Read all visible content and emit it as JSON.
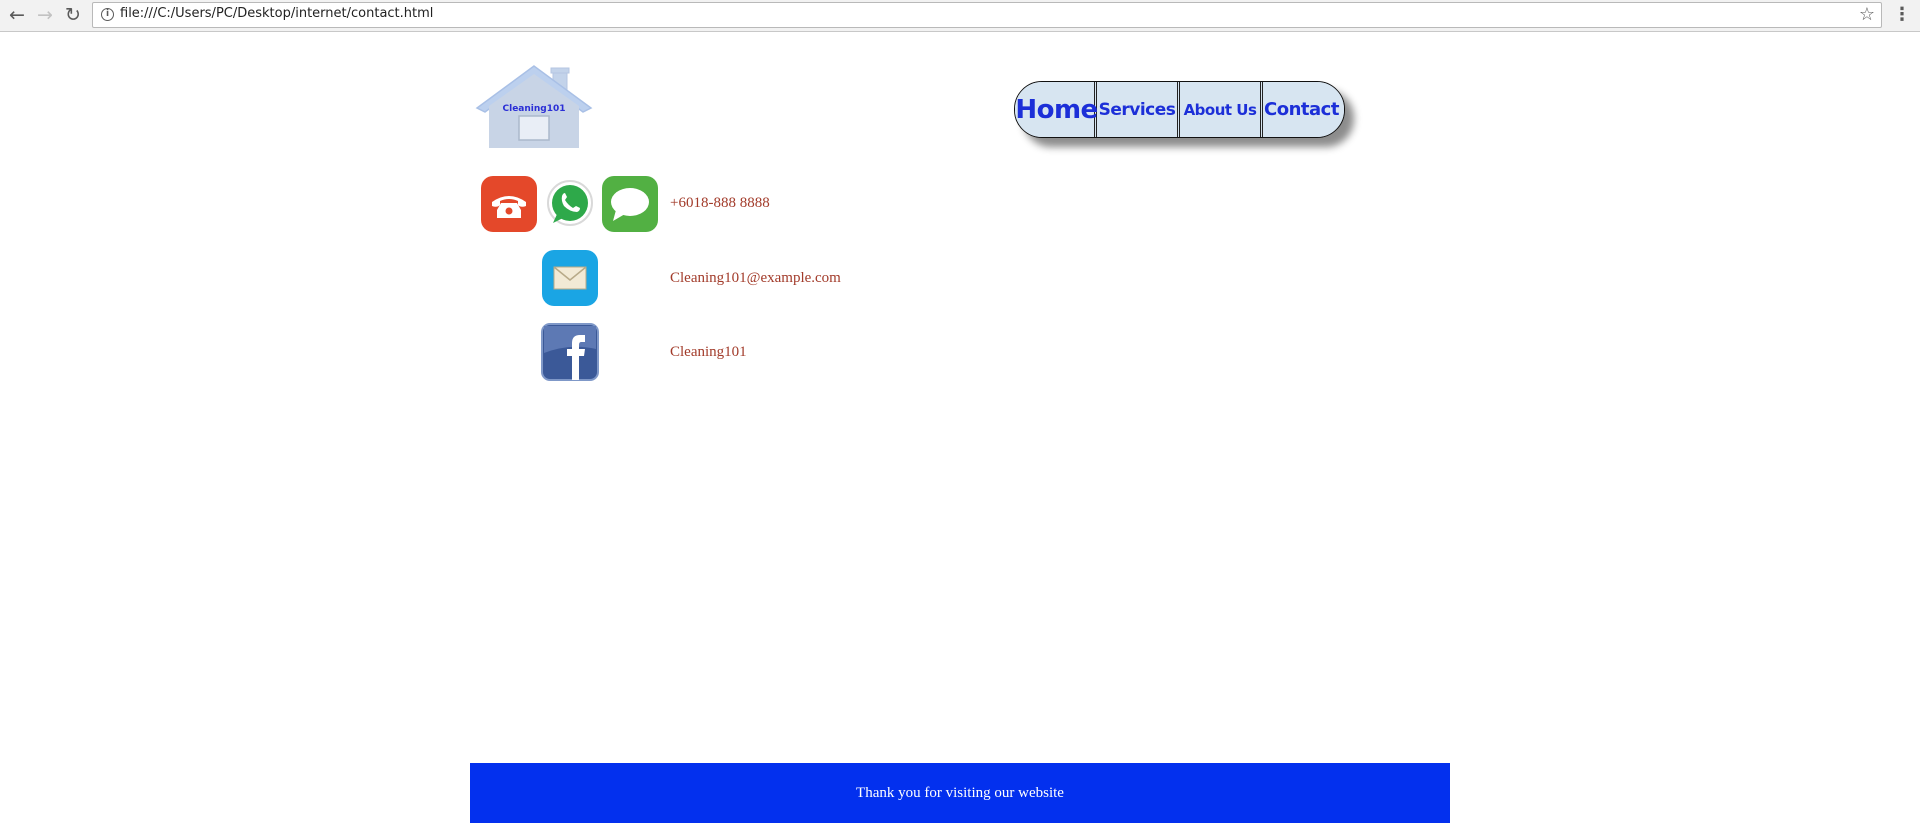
{
  "browser": {
    "url": "file:///C:/Users/PC/Desktop/internet/contact.html"
  },
  "logo": {
    "text": "Cleaning101"
  },
  "nav": {
    "items": [
      {
        "label": "Home"
      },
      {
        "label": "Services"
      },
      {
        "label": "About Us"
      },
      {
        "label": "Contact"
      }
    ]
  },
  "contacts": {
    "phone": "+6018-888 8888",
    "email": "Cleaning101@example.com",
    "facebook": "Cleaning101"
  },
  "footer": {
    "text": "Thank you for visiting our website"
  },
  "colors": {
    "nav_text": "#1c2fd8",
    "nav_bg": "#d7e5f1",
    "contact_text": "#a23b2a",
    "footer_bg": "#0330ee"
  }
}
